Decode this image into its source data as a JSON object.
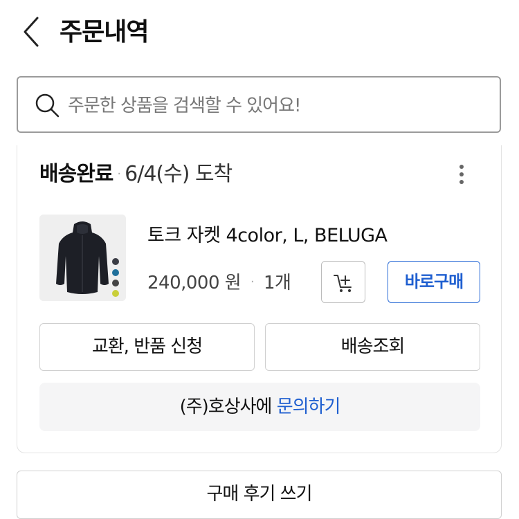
{
  "header": {
    "title": "주문내역",
    "back_icon": "chevron-left-icon"
  },
  "search": {
    "placeholder": "주문한 상품을 검색할 수 있어요!",
    "value": "",
    "icon": "search-icon"
  },
  "order": {
    "status": "배송완료",
    "separator": "·",
    "arrival": "6/4(수) 도착",
    "more_icon": "more-vertical-icon",
    "product": {
      "name": "토크 자켓 4color, L, BELUGA",
      "price": "240,000 원",
      "price_sep": "·",
      "quantity": "1개",
      "image_icon": "jacket-image",
      "swatch_colors": [
        "#3a3c44",
        "#1e6f9a",
        "#444444",
        "#c9cf3a"
      ]
    },
    "cart_icon": "add-to-cart-icon",
    "buy_now_label": "바로구매",
    "exchange_return_label": "교환, 반품 신청",
    "tracking_label": "배송조회",
    "seller_name": "(주)호상사에",
    "inquiry_link": "문의하기"
  },
  "review_button_label": "구매 후기 쓰기",
  "colors": {
    "accent": "#1f5fd0",
    "border": "#cfcfcf",
    "inquiry_bg": "#f5f5f6"
  }
}
